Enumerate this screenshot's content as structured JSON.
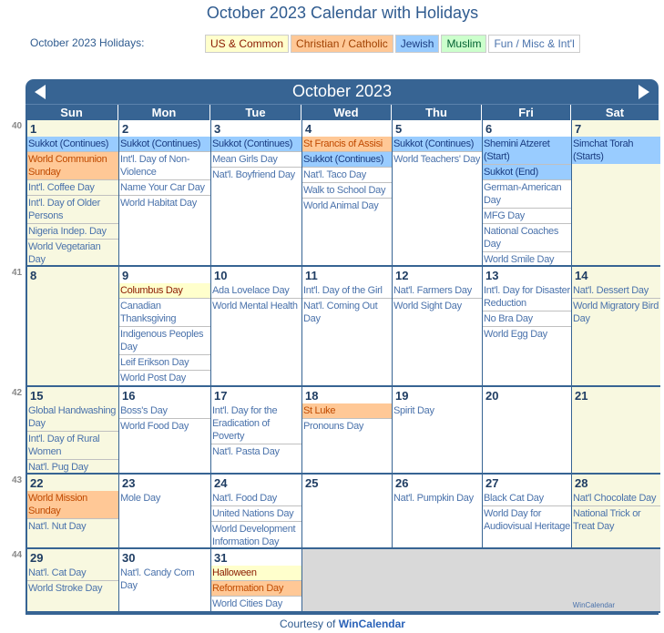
{
  "title": "October 2023 Calendar with Holidays",
  "legend": {
    "label": "October 2023 Holidays:",
    "items": [
      {
        "label": "US & Common",
        "cat": "us"
      },
      {
        "label": "Christian / Catholic",
        "cat": "chr"
      },
      {
        "label": "Jewish",
        "cat": "jew"
      },
      {
        "label": "Muslim",
        "cat": "mus"
      },
      {
        "label": "Fun / Misc & Int'l",
        "cat": "fun"
      }
    ]
  },
  "colors": {
    "header": "#376493",
    "us": "#ffffcc",
    "christian": "#ffc896",
    "jewish": "#99ccff",
    "muslim": "#ccffcc",
    "weekend": "#f8f8e0",
    "empty": "#d9d9d9"
  },
  "calendar": {
    "month_label": "October 2023",
    "prev_icon": "triangle-left",
    "next_icon": "triangle-right",
    "weekdays": [
      "Sun",
      "Mon",
      "Tue",
      "Wed",
      "Thu",
      "Fri",
      "Sat"
    ],
    "weeks": [
      {
        "num": "40",
        "days": [
          {
            "d": "1",
            "we": true,
            "events": [
              [
                "Sukkot (Continues)",
                "jew"
              ],
              [
                "World Communion Sunday",
                "chr"
              ],
              [
                "Int'l. Coffee Day",
                "fun"
              ],
              [
                "Int'l. Day of Older Persons",
                "fun"
              ],
              [
                "Nigeria Indep. Day",
                "fun"
              ],
              [
                "World Vegetarian Day",
                "fun"
              ]
            ]
          },
          {
            "d": "2",
            "events": [
              [
                "Sukkot (Continues)",
                "jew"
              ],
              [
                "Int'l. Day of Non-Violence",
                "fun"
              ],
              [
                "Name Your Car Day",
                "fun"
              ],
              [
                "World Habitat Day",
                "fun"
              ]
            ]
          },
          {
            "d": "3",
            "events": [
              [
                "Sukkot (Continues)",
                "jew"
              ],
              [
                "Mean Girls Day",
                "fun"
              ],
              [
                "Nat'l. Boyfriend Day",
                "fun"
              ]
            ]
          },
          {
            "d": "4",
            "events": [
              [
                "St Francis of Assisi",
                "chr"
              ],
              [
                "Sukkot (Continues)",
                "jew"
              ],
              [
                "Nat'l. Taco Day",
                "fun"
              ],
              [
                "Walk to School Day",
                "fun"
              ],
              [
                "World Animal Day",
                "fun"
              ]
            ]
          },
          {
            "d": "5",
            "events": [
              [
                "Sukkot (Continues)",
                "jew"
              ],
              [
                "World Teachers' Day",
                "fun"
              ]
            ]
          },
          {
            "d": "6",
            "events": [
              [
                "Shemini Atzeret (Start)",
                "jew"
              ],
              [
                "Sukkot (End)",
                "jew"
              ],
              [
                "German-American Day",
                "fun"
              ],
              [
                "MFG Day",
                "fun"
              ],
              [
                "National Coaches Day",
                "fun"
              ],
              [
                "World Smile Day",
                "fun"
              ]
            ]
          },
          {
            "d": "7",
            "we": true,
            "events": [
              [
                "Simchat Torah (Starts)",
                "jew"
              ]
            ]
          }
        ]
      },
      {
        "num": "41",
        "days": [
          {
            "d": "8",
            "we": true,
            "events": []
          },
          {
            "d": "9",
            "events": [
              [
                "Columbus Day",
                "us"
              ],
              [
                "Canadian Thanksgiving",
                "fun"
              ],
              [
                "Indigenous Peoples Day",
                "fun"
              ],
              [
                "Leif Erikson Day",
                "fun"
              ],
              [
                "World Post Day",
                "fun"
              ]
            ]
          },
          {
            "d": "10",
            "events": [
              [
                "Ada Lovelace Day",
                "fun"
              ],
              [
                "World Mental Health",
                "fun"
              ]
            ]
          },
          {
            "d": "11",
            "events": [
              [
                "Int'l. Day of the Girl",
                "fun"
              ],
              [
                "Nat'l. Coming Out Day",
                "fun"
              ]
            ]
          },
          {
            "d": "12",
            "events": [
              [
                "Nat'l. Farmers Day",
                "fun"
              ],
              [
                "World Sight Day",
                "fun"
              ]
            ]
          },
          {
            "d": "13",
            "events": [
              [
                "Int'l. Day for Disaster Reduction",
                "fun"
              ],
              [
                "No Bra Day",
                "fun"
              ],
              [
                "World Egg Day",
                "fun"
              ]
            ]
          },
          {
            "d": "14",
            "we": true,
            "events": [
              [
                "Nat'l. Dessert Day",
                "fun"
              ],
              [
                "World Migratory Bird Day",
                "fun"
              ]
            ]
          }
        ]
      },
      {
        "num": "42",
        "days": [
          {
            "d": "15",
            "we": true,
            "events": [
              [
                "Global Handwashing Day",
                "fun"
              ],
              [
                "Int'l. Day of Rural Women",
                "fun"
              ],
              [
                "Nat'l. Pug Day",
                "fun"
              ]
            ]
          },
          {
            "d": "16",
            "events": [
              [
                "Boss's Day",
                "fun"
              ],
              [
                "World Food Day",
                "fun"
              ]
            ]
          },
          {
            "d": "17",
            "events": [
              [
                "Int'l. Day for the Eradication of Poverty",
                "fun"
              ],
              [
                "Nat'l. Pasta Day",
                "fun"
              ]
            ]
          },
          {
            "d": "18",
            "events": [
              [
                "St Luke",
                "chr"
              ],
              [
                "Pronouns Day",
                "fun"
              ]
            ]
          },
          {
            "d": "19",
            "events": [
              [
                "Spirit Day",
                "fun"
              ]
            ]
          },
          {
            "d": "20",
            "events": []
          },
          {
            "d": "21",
            "we": true,
            "events": []
          }
        ]
      },
      {
        "num": "43",
        "days": [
          {
            "d": "22",
            "we": true,
            "events": [
              [
                "World Mission Sunday",
                "chr"
              ],
              [
                "Nat'l. Nut Day",
                "fun"
              ]
            ]
          },
          {
            "d": "23",
            "events": [
              [
                "Mole Day",
                "fun"
              ]
            ]
          },
          {
            "d": "24",
            "events": [
              [
                "Nat'l. Food Day",
                "fun"
              ],
              [
                "United Nations Day",
                "fun"
              ],
              [
                "World Development Information Day",
                "fun"
              ]
            ]
          },
          {
            "d": "25",
            "events": []
          },
          {
            "d": "26",
            "events": [
              [
                "Nat'l. Pumpkin Day",
                "fun"
              ]
            ]
          },
          {
            "d": "27",
            "events": [
              [
                "Black Cat Day",
                "fun"
              ],
              [
                "World Day for Audiovisual Heritage",
                "fun"
              ]
            ]
          },
          {
            "d": "28",
            "we": true,
            "events": [
              [
                "Nat'l Chocolate Day",
                "fun"
              ],
              [
                "National Trick or Treat Day",
                "fun"
              ]
            ]
          }
        ]
      },
      {
        "num": "44",
        "days": [
          {
            "d": "29",
            "we": true,
            "events": [
              [
                "Nat'l. Cat Day",
                "fun"
              ],
              [
                "World Stroke Day",
                "fun"
              ]
            ]
          },
          {
            "d": "30",
            "events": [
              [
                "Nat'l. Candy Corn Day",
                "fun"
              ]
            ]
          },
          {
            "d": "31",
            "events": [
              [
                "Halloween",
                "us"
              ],
              [
                "Reformation Day",
                "chr"
              ],
              [
                "World Cities Day",
                "fun"
              ]
            ]
          }
        ]
      }
    ],
    "watermark": "WinCalendar"
  },
  "footer": {
    "prefix": "Courtesy of ",
    "link": "WinCalendar"
  }
}
